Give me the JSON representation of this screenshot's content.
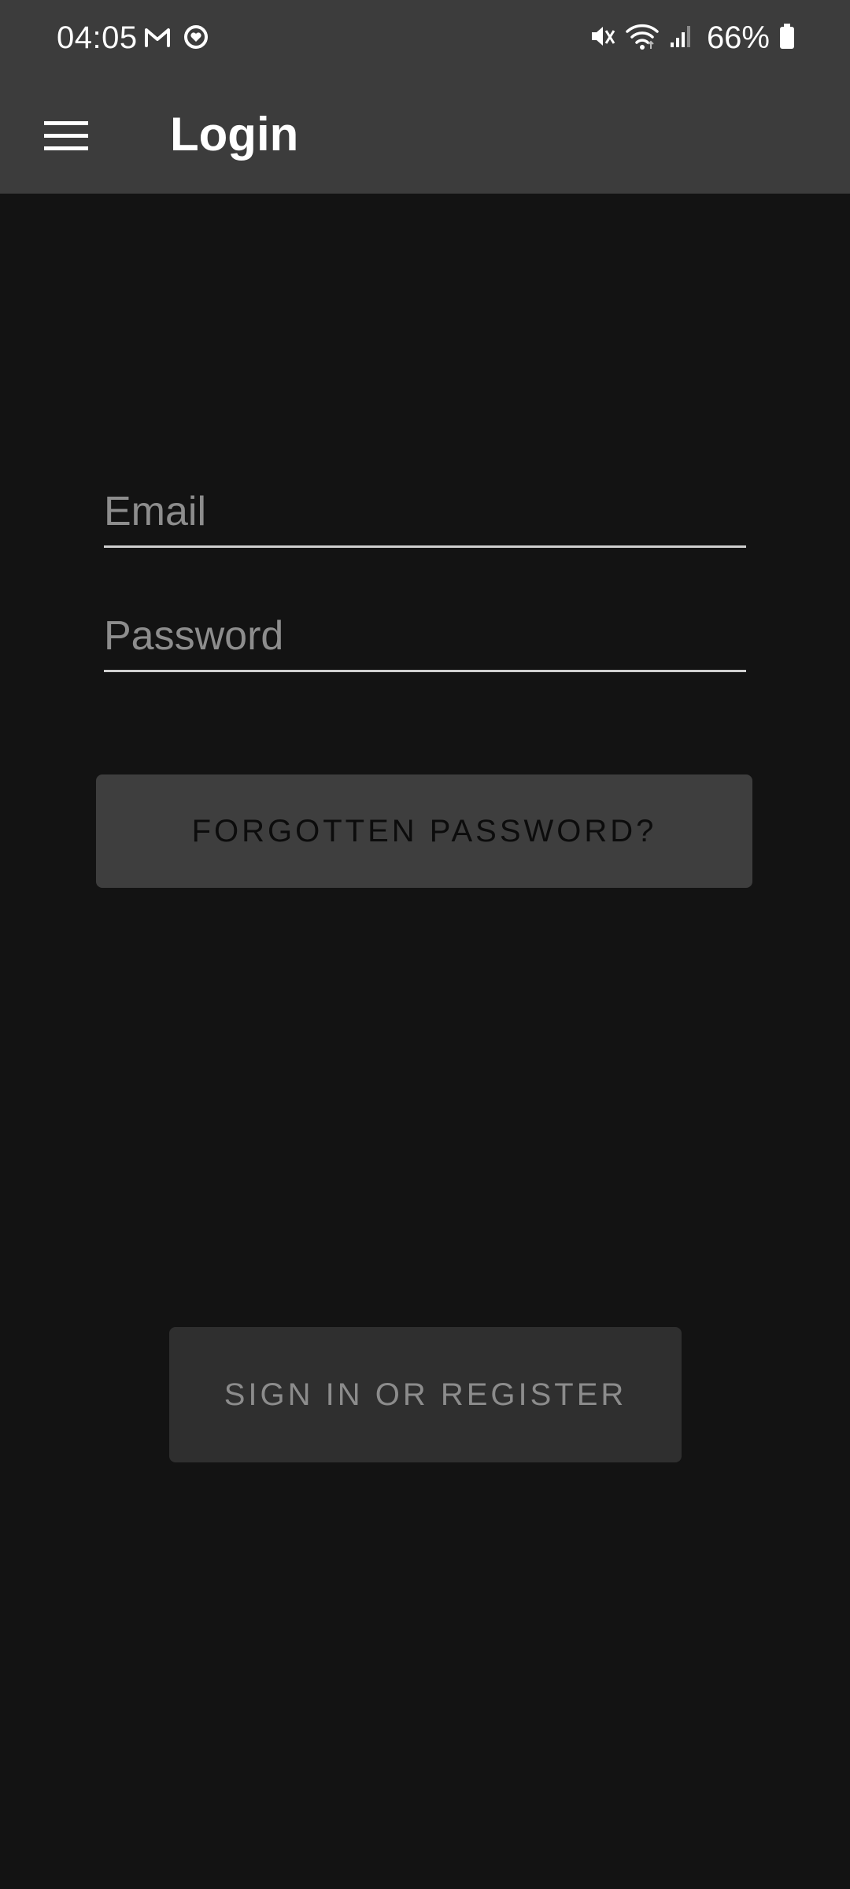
{
  "status_bar": {
    "time": "04:05",
    "battery": "66%",
    "icons": [
      "gmail-icon",
      "heart-circle-icon",
      "mute-icon",
      "wifi-icon",
      "signal-icon",
      "battery-icon"
    ]
  },
  "app_bar": {
    "title": "Login",
    "menu_icon": "hamburger-menu-icon"
  },
  "form": {
    "email_placeholder": "Email",
    "email_value": "",
    "password_placeholder": "Password",
    "password_value": ""
  },
  "buttons": {
    "forgot_password": "FORGOTTEN PASSWORD?",
    "sign_in": "SIGN IN OR REGISTER"
  },
  "colors": {
    "background": "#131313",
    "app_bar": "#3c3c3c",
    "primary_button": "#3e3e3e",
    "disabled_button": "#2f2f2f"
  }
}
